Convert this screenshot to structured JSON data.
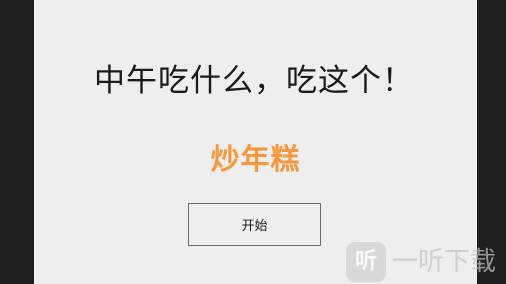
{
  "app": {
    "prompt_text": "中午吃什么，吃这个！",
    "result_text": "炒年糕",
    "start_button_label": "开始"
  },
  "watermark": {
    "logo_glyph": "听",
    "text": "一听下载"
  },
  "colors": {
    "background": "#eeeeee",
    "side_bars": "#1f1f1f",
    "result_accent": "#f6973c",
    "text": "#1a1a1a",
    "button_border": "#6d6d6d"
  }
}
